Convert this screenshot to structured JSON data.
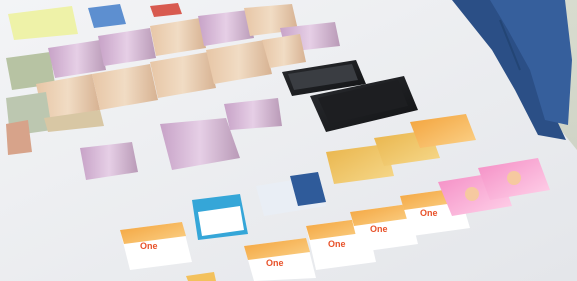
{
  "photo": {
    "subject": "table-with-seized-items",
    "item_kinds": [
      "banknote-bundle",
      "smartphone",
      "bank-card",
      "prepaid-phone-card"
    ]
  },
  "card_texts": {
    "prepaid_brand": "One"
  }
}
